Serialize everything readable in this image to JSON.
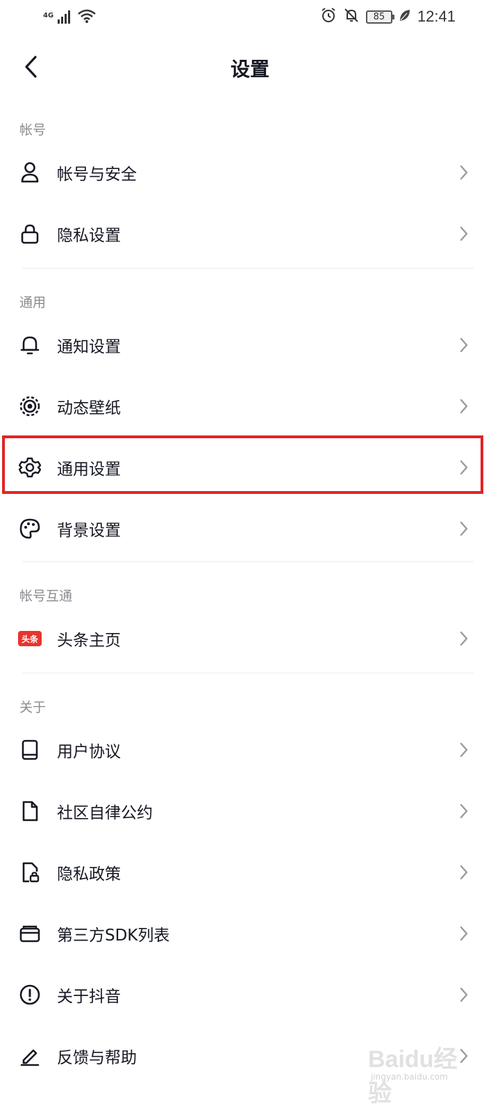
{
  "status_bar": {
    "network": "4G",
    "battery": "85",
    "time": "12:41"
  },
  "header": {
    "title": "设置"
  },
  "sections": [
    {
      "title": "帐号",
      "items": [
        {
          "label": "帐号与安全",
          "icon": "user-icon"
        },
        {
          "label": "隐私设置",
          "icon": "lock-icon"
        }
      ]
    },
    {
      "title": "通用",
      "items": [
        {
          "label": "通知设置",
          "icon": "bell-icon"
        },
        {
          "label": "动态壁纸",
          "icon": "wallpaper-icon"
        },
        {
          "label": "通用设置",
          "icon": "gear-icon"
        },
        {
          "label": "背景设置",
          "icon": "palette-icon"
        }
      ]
    },
    {
      "title": "帐号互通",
      "items": [
        {
          "label": "头条主页",
          "icon": "toutiao-icon",
          "badge": "头条"
        }
      ]
    },
    {
      "title": "关于",
      "items": [
        {
          "label": "用户协议",
          "icon": "book-icon"
        },
        {
          "label": "社区自律公约",
          "icon": "document-icon"
        },
        {
          "label": "隐私政策",
          "icon": "privacy-doc-icon"
        },
        {
          "label": "第三方SDK列表",
          "icon": "wallet-icon"
        },
        {
          "label": "关于抖音",
          "icon": "info-icon"
        },
        {
          "label": "反馈与帮助",
          "icon": "edit-icon"
        }
      ]
    }
  ],
  "watermark": {
    "brand": "Baidu经验",
    "url": "jingyan.baidu.com"
  }
}
